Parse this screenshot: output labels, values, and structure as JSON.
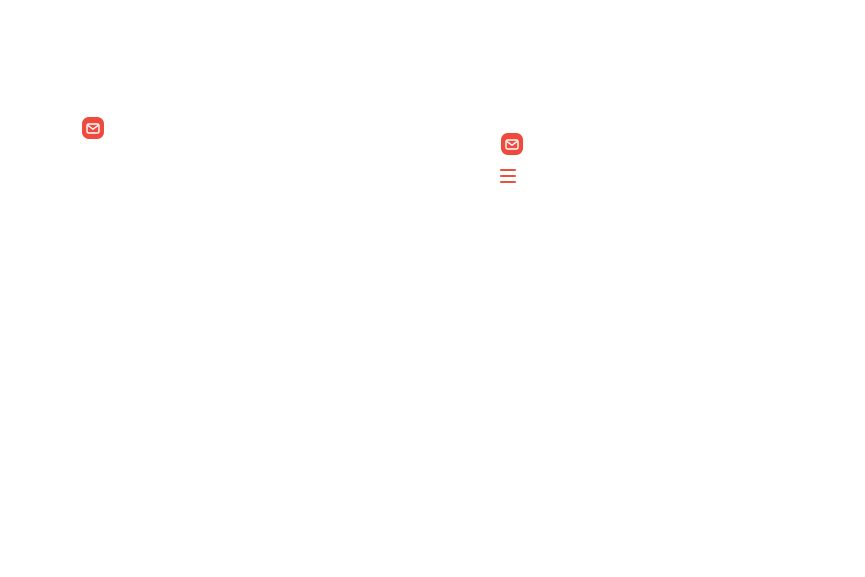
{
  "icons": {
    "left_email_app": "email-app-icon",
    "right_email_app": "email-app-icon",
    "menu": "menu-icon"
  },
  "colors": {
    "email_icon_background": "#ee4a3e",
    "menu_icon": "#e8523f"
  }
}
